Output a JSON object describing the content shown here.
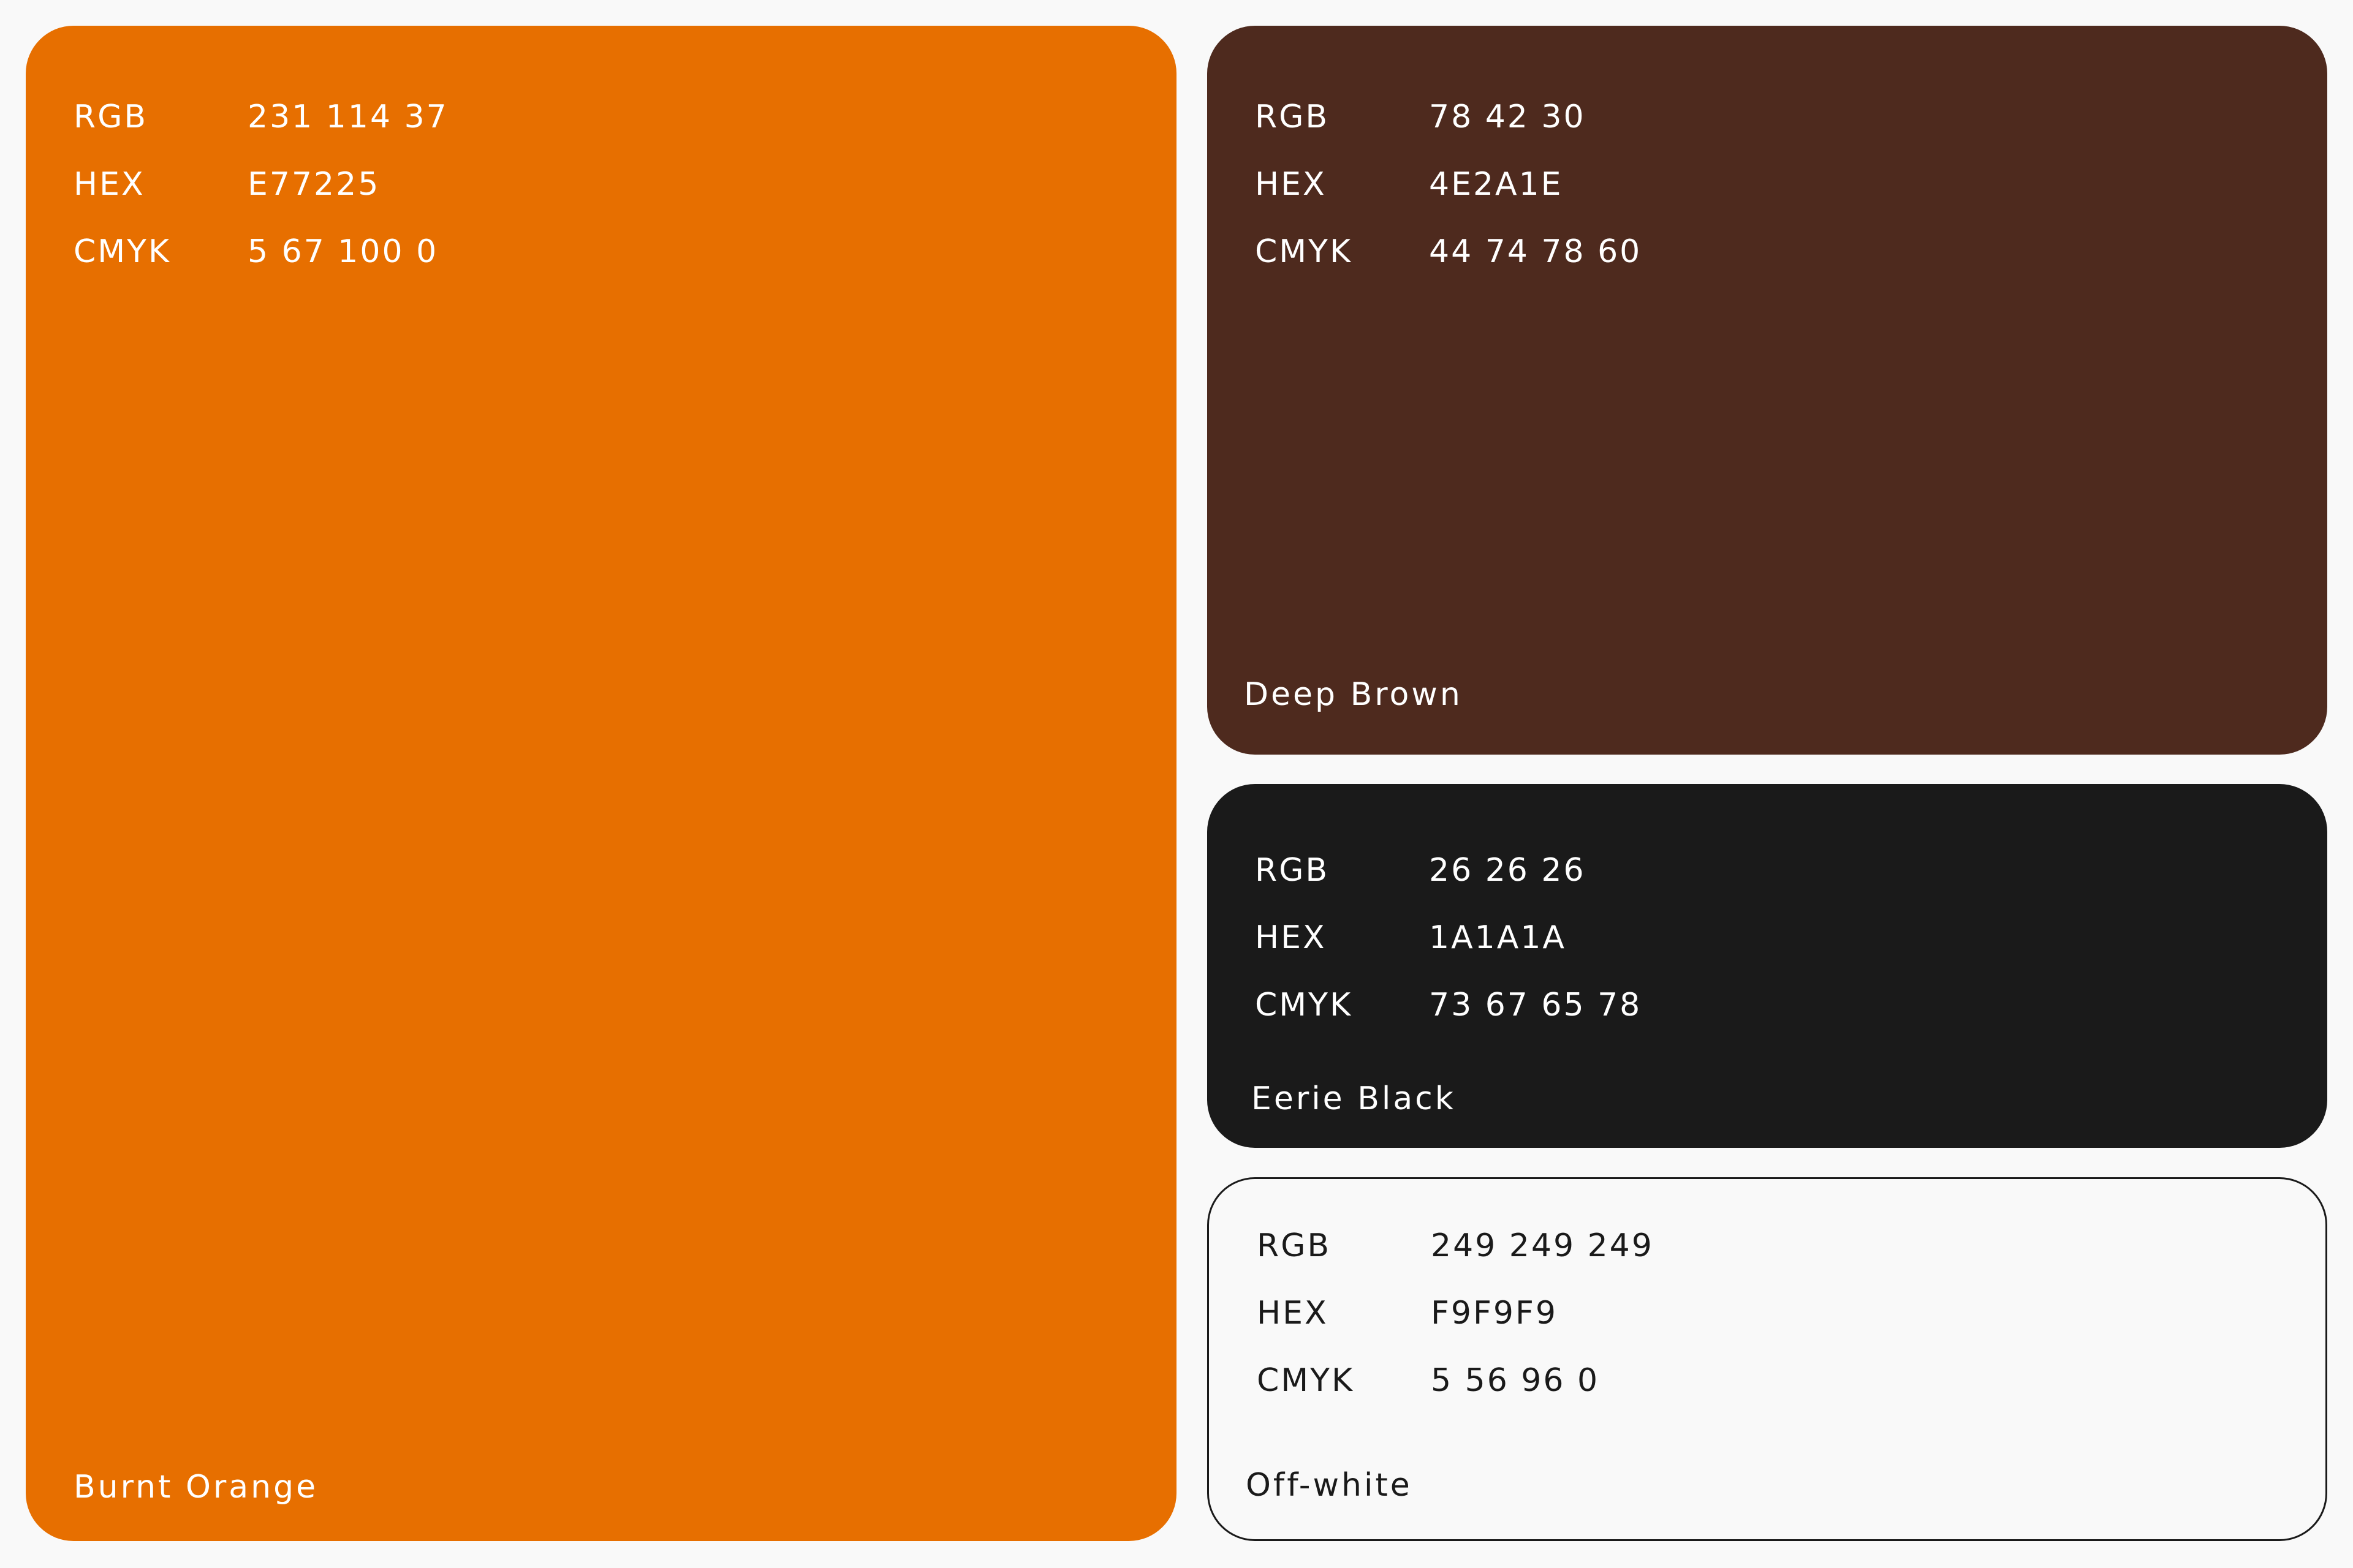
{
  "palette": [
    {
      "name": "Burnt Orange",
      "swatch_color": "#E77225",
      "rgb_label": "RGB",
      "rgb": "231 114 37",
      "hex_label": "HEX",
      "hex": "E77225",
      "cmyk_label": "CMYK",
      "cmyk": "5 67 100 0"
    },
    {
      "name": "Deep Brown",
      "swatch_color": "#4E2A1E",
      "rgb_label": "RGB",
      "rgb": "78 42 30",
      "hex_label": "HEX",
      "hex": "4E2A1E",
      "cmyk_label": "CMYK",
      "cmyk": "44 74 78 60"
    },
    {
      "name": "Eerie Black",
      "swatch_color": "#1A1A1A",
      "rgb_label": "RGB",
      "rgb": "26 26 26",
      "hex_label": "HEX",
      "hex": "1A1A1A",
      "cmyk_label": "CMYK",
      "cmyk": "73 67 65 78"
    },
    {
      "name": "Off-white",
      "swatch_color": "#F9F9F9",
      "rgb_label": "RGB",
      "rgb": "249 249 249",
      "hex_label": "HEX",
      "hex": "F9F9F9",
      "cmyk_label": "CMYK",
      "cmyk": "5 56 96 0"
    }
  ]
}
